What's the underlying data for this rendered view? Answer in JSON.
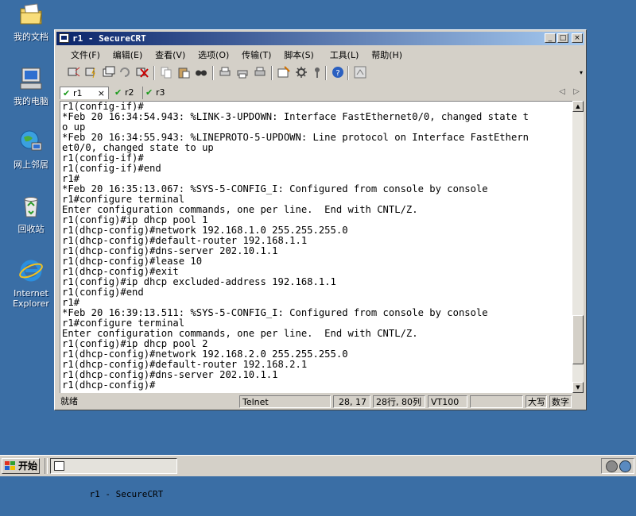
{
  "desktop": {
    "icons": [
      {
        "label": "我的文档",
        "icon": "my-documents-icon"
      },
      {
        "label": "我的电脑",
        "icon": "my-computer-icon"
      },
      {
        "label": "网上邻居",
        "icon": "network-places-icon"
      },
      {
        "label": "回收站",
        "icon": "recycle-bin-icon"
      },
      {
        "label": "Internet Explorer",
        "icon": "internet-explorer-icon"
      }
    ]
  },
  "window": {
    "title": "r1 - SecureCRT",
    "controls": [
      "_",
      "□",
      "×"
    ]
  },
  "menu": [
    "文件(F)",
    "编辑(E)",
    "查看(V)",
    "选项(O)",
    "传输(T)",
    "脚本(S)",
    "工具(L)",
    "帮助(H)"
  ],
  "tabs": [
    {
      "label": "r1",
      "active": true,
      "close": "×"
    },
    {
      "label": "r2",
      "active": false
    },
    {
      "label": "r3",
      "active": false
    }
  ],
  "tab_nav": {
    "prev": "◁",
    "next": "▷"
  },
  "terminal": {
    "lines": [
      "r1(config-if)#",
      "*Feb 20 16:34:54.943: %LINK-3-UPDOWN: Interface FastEthernet0/0, changed state t",
      "o up",
      "*Feb 20 16:34:55.943: %LINEPROTO-5-UPDOWN: Line protocol on Interface FastEthern",
      "et0/0, changed state to up",
      "r1(config-if)#",
      "r1(config-if)#end",
      "r1#",
      "*Feb 20 16:35:13.067: %SYS-5-CONFIG_I: Configured from console by console",
      "r1#configure terminal",
      "Enter configuration commands, one per line.  End with CNTL/Z.",
      "r1(config)#ip dhcp pool 1",
      "r1(dhcp-config)#network 192.168.1.0 255.255.255.0",
      "r1(dhcp-config)#default-router 192.168.1.1",
      "r1(dhcp-config)#dns-server 202.10.1.1",
      "r1(dhcp-config)#lease 10",
      "r1(dhcp-config)#exit",
      "r1(config)#ip dhcp excluded-address 192.168.1.1",
      "r1(config)#end",
      "r1#",
      "*Feb 20 16:39:13.511: %SYS-5-CONFIG_I: Configured from console by console",
      "r1#configure terminal",
      "Enter configuration commands, one per line.  End with CNTL/Z.",
      "r1(config)#ip dhcp pool 2",
      "r1(dhcp-config)#network 192.168.2.0 255.255.255.0",
      "r1(dhcp-config)#default-router 192.168.2.1",
      "r1(dhcp-config)#dns-server 202.10.1.1",
      "r1(dhcp-config)#"
    ],
    "scroll_position": 0.92
  },
  "status": {
    "state": "就绪",
    "protocol": "Telnet",
    "cursor": "28, 17",
    "size": "28行, 80列",
    "emulation": "VT100",
    "caps": "大写",
    "num": "数字"
  },
  "taskbar": {
    "start_label": "开始",
    "task_label": "r1 - SecureCRT"
  },
  "colors": {
    "desktop": "#3a6ea5",
    "title_start": "#0a246a",
    "title_end": "#a6caf0",
    "chrome": "#d4d0c8",
    "tab_check": "#1a9a1a"
  }
}
